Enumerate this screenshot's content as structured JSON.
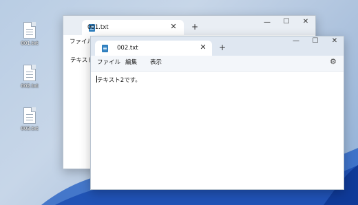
{
  "desktop": {
    "icons": [
      {
        "label": "001.txt"
      },
      {
        "label": "002.txt"
      },
      {
        "label": "003.txt"
      }
    ]
  },
  "back_window": {
    "tab_title": "001.txt",
    "menu": [
      "ファイル"
    ],
    "content": "テキスト1"
  },
  "front_window": {
    "tab_title": "002.txt",
    "menu": [
      "ファイル",
      "編集",
      "表示"
    ],
    "content": "テキスト2です。"
  },
  "icons": {
    "close": "✕",
    "new_tab": "+",
    "minimize": "—",
    "maximize": "☐",
    "settings": "⚙"
  },
  "colors": {
    "titlebar_front": "#dfe7f1",
    "titlebar_back": "#e9eef4",
    "notepad_icon": "#2f7fbf"
  }
}
